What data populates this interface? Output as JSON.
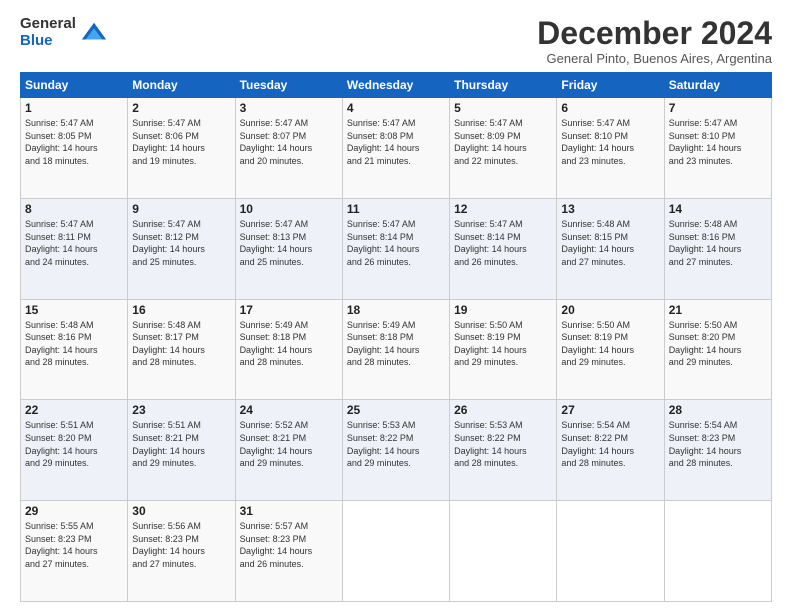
{
  "logo": {
    "general": "General",
    "blue": "Blue"
  },
  "header": {
    "month": "December 2024",
    "location": "General Pinto, Buenos Aires, Argentina"
  },
  "weekdays": [
    "Sunday",
    "Monday",
    "Tuesday",
    "Wednesday",
    "Thursday",
    "Friday",
    "Saturday"
  ],
  "weeks": [
    [
      {
        "day": "1",
        "lines": [
          "Sunrise: 5:47 AM",
          "Sunset: 8:05 PM",
          "Daylight: 14 hours",
          "and 18 minutes."
        ]
      },
      {
        "day": "2",
        "lines": [
          "Sunrise: 5:47 AM",
          "Sunset: 8:06 PM",
          "Daylight: 14 hours",
          "and 19 minutes."
        ]
      },
      {
        "day": "3",
        "lines": [
          "Sunrise: 5:47 AM",
          "Sunset: 8:07 PM",
          "Daylight: 14 hours",
          "and 20 minutes."
        ]
      },
      {
        "day": "4",
        "lines": [
          "Sunrise: 5:47 AM",
          "Sunset: 8:08 PM",
          "Daylight: 14 hours",
          "and 21 minutes."
        ]
      },
      {
        "day": "5",
        "lines": [
          "Sunrise: 5:47 AM",
          "Sunset: 8:09 PM",
          "Daylight: 14 hours",
          "and 22 minutes."
        ]
      },
      {
        "day": "6",
        "lines": [
          "Sunrise: 5:47 AM",
          "Sunset: 8:10 PM",
          "Daylight: 14 hours",
          "and 23 minutes."
        ]
      },
      {
        "day": "7",
        "lines": [
          "Sunrise: 5:47 AM",
          "Sunset: 8:10 PM",
          "Daylight: 14 hours",
          "and 23 minutes."
        ]
      }
    ],
    [
      {
        "day": "8",
        "lines": [
          "Sunrise: 5:47 AM",
          "Sunset: 8:11 PM",
          "Daylight: 14 hours",
          "and 24 minutes."
        ]
      },
      {
        "day": "9",
        "lines": [
          "Sunrise: 5:47 AM",
          "Sunset: 8:12 PM",
          "Daylight: 14 hours",
          "and 25 minutes."
        ]
      },
      {
        "day": "10",
        "lines": [
          "Sunrise: 5:47 AM",
          "Sunset: 8:13 PM",
          "Daylight: 14 hours",
          "and 25 minutes."
        ]
      },
      {
        "day": "11",
        "lines": [
          "Sunrise: 5:47 AM",
          "Sunset: 8:14 PM",
          "Daylight: 14 hours",
          "and 26 minutes."
        ]
      },
      {
        "day": "12",
        "lines": [
          "Sunrise: 5:47 AM",
          "Sunset: 8:14 PM",
          "Daylight: 14 hours",
          "and 26 minutes."
        ]
      },
      {
        "day": "13",
        "lines": [
          "Sunrise: 5:48 AM",
          "Sunset: 8:15 PM",
          "Daylight: 14 hours",
          "and 27 minutes."
        ]
      },
      {
        "day": "14",
        "lines": [
          "Sunrise: 5:48 AM",
          "Sunset: 8:16 PM",
          "Daylight: 14 hours",
          "and 27 minutes."
        ]
      }
    ],
    [
      {
        "day": "15",
        "lines": [
          "Sunrise: 5:48 AM",
          "Sunset: 8:16 PM",
          "Daylight: 14 hours",
          "and 28 minutes."
        ]
      },
      {
        "day": "16",
        "lines": [
          "Sunrise: 5:48 AM",
          "Sunset: 8:17 PM",
          "Daylight: 14 hours",
          "and 28 minutes."
        ]
      },
      {
        "day": "17",
        "lines": [
          "Sunrise: 5:49 AM",
          "Sunset: 8:18 PM",
          "Daylight: 14 hours",
          "and 28 minutes."
        ]
      },
      {
        "day": "18",
        "lines": [
          "Sunrise: 5:49 AM",
          "Sunset: 8:18 PM",
          "Daylight: 14 hours",
          "and 28 minutes."
        ]
      },
      {
        "day": "19",
        "lines": [
          "Sunrise: 5:50 AM",
          "Sunset: 8:19 PM",
          "Daylight: 14 hours",
          "and 29 minutes."
        ]
      },
      {
        "day": "20",
        "lines": [
          "Sunrise: 5:50 AM",
          "Sunset: 8:19 PM",
          "Daylight: 14 hours",
          "and 29 minutes."
        ]
      },
      {
        "day": "21",
        "lines": [
          "Sunrise: 5:50 AM",
          "Sunset: 8:20 PM",
          "Daylight: 14 hours",
          "and 29 minutes."
        ]
      }
    ],
    [
      {
        "day": "22",
        "lines": [
          "Sunrise: 5:51 AM",
          "Sunset: 8:20 PM",
          "Daylight: 14 hours",
          "and 29 minutes."
        ]
      },
      {
        "day": "23",
        "lines": [
          "Sunrise: 5:51 AM",
          "Sunset: 8:21 PM",
          "Daylight: 14 hours",
          "and 29 minutes."
        ]
      },
      {
        "day": "24",
        "lines": [
          "Sunrise: 5:52 AM",
          "Sunset: 8:21 PM",
          "Daylight: 14 hours",
          "and 29 minutes."
        ]
      },
      {
        "day": "25",
        "lines": [
          "Sunrise: 5:53 AM",
          "Sunset: 8:22 PM",
          "Daylight: 14 hours",
          "and 29 minutes."
        ]
      },
      {
        "day": "26",
        "lines": [
          "Sunrise: 5:53 AM",
          "Sunset: 8:22 PM",
          "Daylight: 14 hours",
          "and 28 minutes."
        ]
      },
      {
        "day": "27",
        "lines": [
          "Sunrise: 5:54 AM",
          "Sunset: 8:22 PM",
          "Daylight: 14 hours",
          "and 28 minutes."
        ]
      },
      {
        "day": "28",
        "lines": [
          "Sunrise: 5:54 AM",
          "Sunset: 8:23 PM",
          "Daylight: 14 hours",
          "and 28 minutes."
        ]
      }
    ],
    [
      {
        "day": "29",
        "lines": [
          "Sunrise: 5:55 AM",
          "Sunset: 8:23 PM",
          "Daylight: 14 hours",
          "and 27 minutes."
        ]
      },
      {
        "day": "30",
        "lines": [
          "Sunrise: 5:56 AM",
          "Sunset: 8:23 PM",
          "Daylight: 14 hours",
          "and 27 minutes."
        ]
      },
      {
        "day": "31",
        "lines": [
          "Sunrise: 5:57 AM",
          "Sunset: 8:23 PM",
          "Daylight: 14 hours",
          "and 26 minutes."
        ]
      },
      null,
      null,
      null,
      null
    ]
  ]
}
